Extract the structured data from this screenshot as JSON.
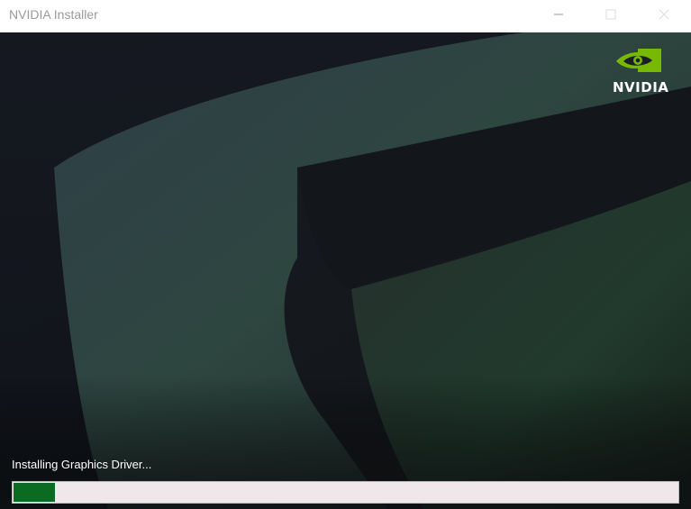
{
  "window": {
    "title": "NVIDIA Installer",
    "minimize_glyph": "—",
    "maximize_glyph": "☐",
    "close_glyph": "✕"
  },
  "brand": {
    "logo_icon": "nvidia-eye-icon",
    "logo_text": "NVIDIA",
    "accent_color": "#76b900"
  },
  "installer": {
    "status_text": "Installing Graphics Driver...",
    "progress_percent": 6.3,
    "progress_color": "#0c6b22",
    "progress_track_color": "#efe7ea"
  }
}
